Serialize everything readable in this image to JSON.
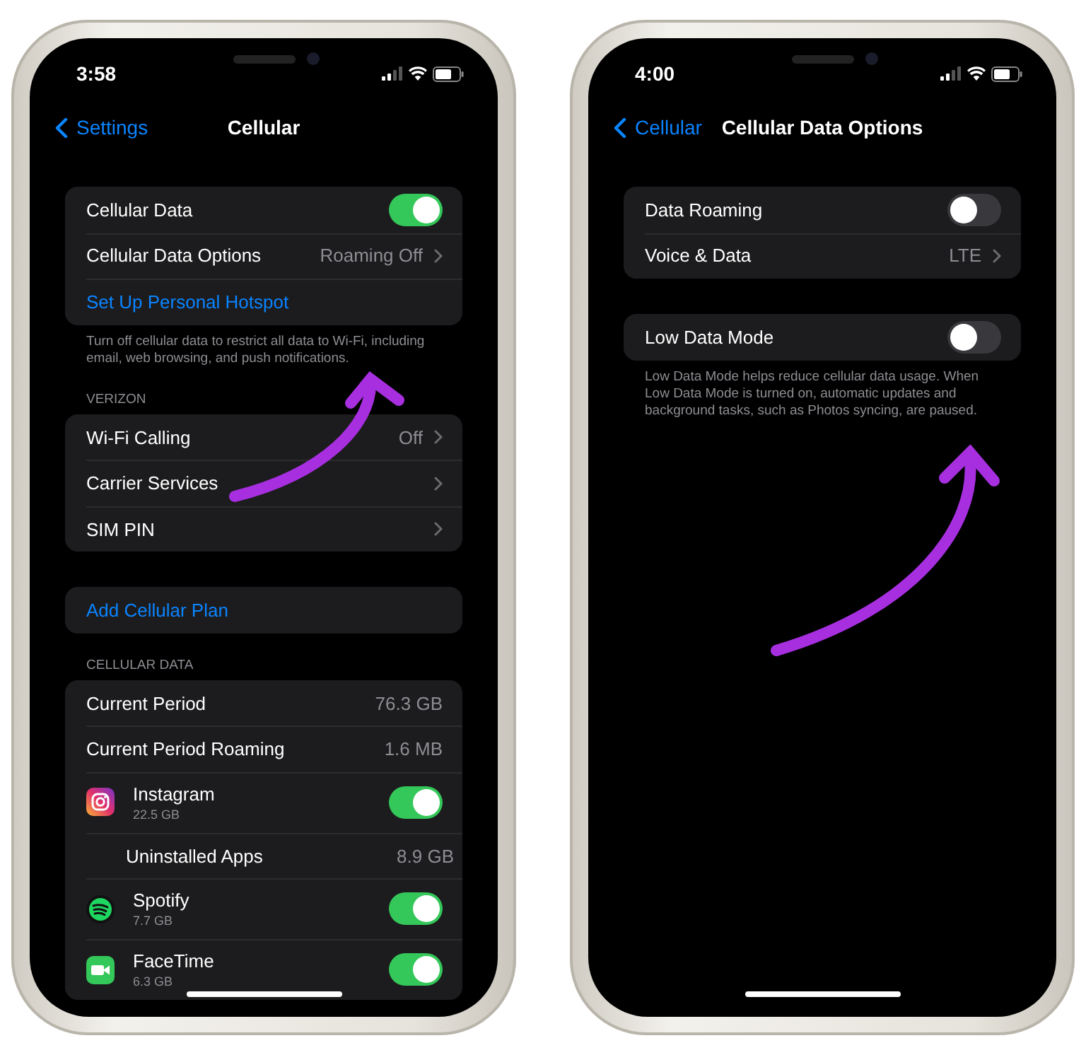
{
  "phones": [
    {
      "time": "3:58",
      "back": "Settings",
      "title": "Cellular",
      "groups": [
        {
          "rows": [
            {
              "kind": "toggle",
              "label": "Cellular Data",
              "on": true
            },
            {
              "kind": "link",
              "label": "Cellular Data Options",
              "value": "Roaming Off"
            },
            {
              "kind": "action",
              "label": "Set Up Personal Hotspot"
            }
          ],
          "footer": "Turn off cellular data to restrict all data to Wi-Fi, including email, web browsing, and push notifications."
        },
        {
          "header": "VERIZON",
          "rows": [
            {
              "kind": "link",
              "label": "Wi-Fi Calling",
              "value": "Off"
            },
            {
              "kind": "link",
              "label": "Carrier Services"
            },
            {
              "kind": "link",
              "label": "SIM PIN"
            }
          ]
        },
        {
          "rows": [
            {
              "kind": "action",
              "label": "Add Cellular Plan"
            }
          ]
        },
        {
          "header": "CELLULAR DATA",
          "rows": [
            {
              "kind": "stat",
              "label": "Current Period",
              "value": "76.3 GB"
            },
            {
              "kind": "stat",
              "label": "Current Period Roaming",
              "value": "1.6 MB"
            },
            {
              "kind": "app",
              "label": "Instagram",
              "sublabel": "22.5 GB",
              "on": true
            },
            {
              "kind": "subitem",
              "label": "Uninstalled Apps",
              "value": "8.9 GB"
            },
            {
              "kind": "app",
              "label": "Spotify",
              "sublabel": "7.7 GB",
              "on": true
            },
            {
              "kind": "app",
              "label": "FaceTime",
              "sublabel": "6.3 GB",
              "on": true
            }
          ]
        }
      ]
    },
    {
      "time": "4:00",
      "back": "Cellular",
      "title": "Cellular Data Options",
      "groups": [
        {
          "rows": [
            {
              "kind": "toggle",
              "label": "Data Roaming",
              "on": false
            },
            {
              "kind": "link",
              "label": "Voice & Data",
              "value": "LTE"
            }
          ]
        },
        {
          "rows": [
            {
              "kind": "toggle",
              "label": "Low Data Mode",
              "on": false
            }
          ],
          "footer": "Low Data Mode helps reduce cellular data usage. When Low Data Mode is turned on, automatic updates and background tasks, such as Photos syncing, are paused."
        }
      ]
    }
  ]
}
